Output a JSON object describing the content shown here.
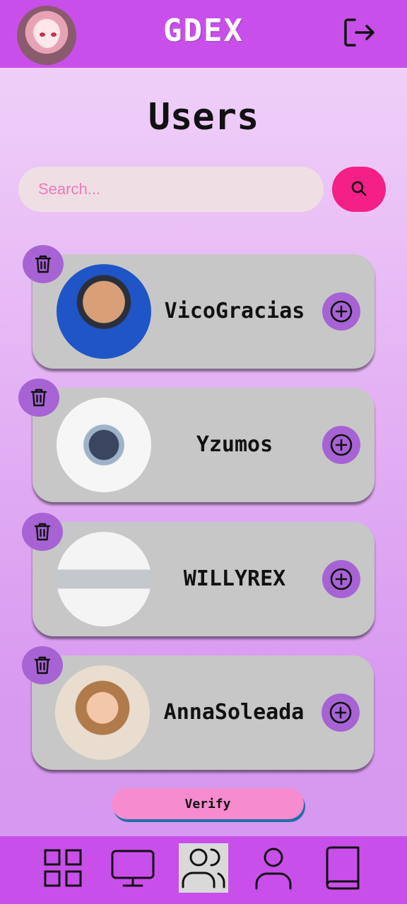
{
  "app": {
    "brand": "GDEX"
  },
  "page": {
    "title": "Users"
  },
  "search": {
    "placeholder": "Search..."
  },
  "users": [
    {
      "name": "VicoGracias"
    },
    {
      "name": "Yzumos"
    },
    {
      "name": "WILLYREX"
    },
    {
      "name": "AnnaSoleada"
    }
  ],
  "actions": {
    "verify_label": "Verify"
  },
  "nav": {
    "items": [
      {
        "icon": "grid-icon"
      },
      {
        "icon": "monitor-icon"
      },
      {
        "icon": "users-icon",
        "active": true
      },
      {
        "icon": "user-icon"
      },
      {
        "icon": "book-icon"
      }
    ]
  },
  "colors": {
    "header": "#c94fea",
    "accent_pink": "#f41f87",
    "button_purple": "#a763d4",
    "card": "#c7c7c7",
    "verify": "#f78bcf"
  }
}
